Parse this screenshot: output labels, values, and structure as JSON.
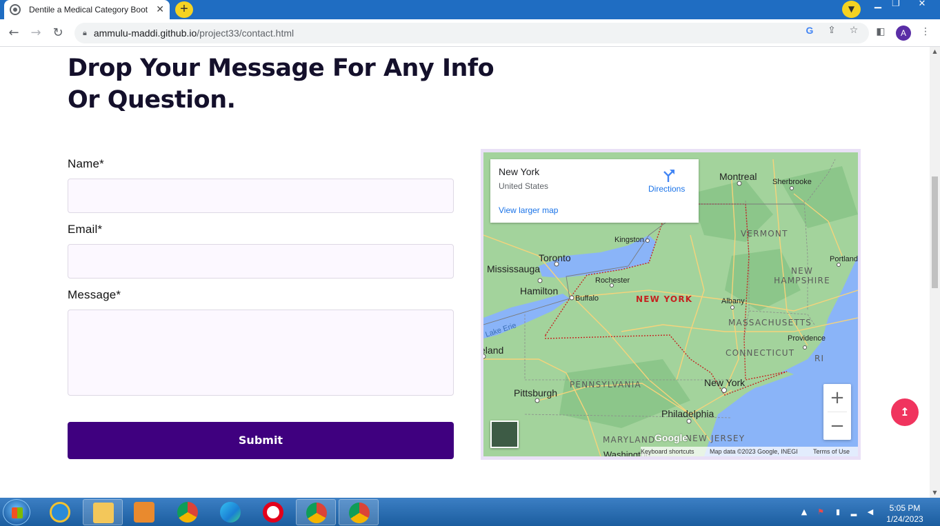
{
  "browser": {
    "tab_title": "Dentile a Medical Category Boot",
    "tab_close": "✕",
    "new_tab": "+",
    "url_host": "ammulu-maddi.github.io",
    "url_path": "/project33/contact.html",
    "profile_initial": "A",
    "window_buttons": [
      "▁",
      "❐",
      "✕"
    ]
  },
  "page": {
    "heading": "Drop Your Message For Any Info Or Question.",
    "form": {
      "name_label": "Name*",
      "email_label": "Email*",
      "message_label": "Message*",
      "submit_label": "Submit"
    },
    "map": {
      "card": {
        "place": "New York",
        "country": "United States",
        "directions": "Directions",
        "larger_map": "View larger map"
      },
      "states": [
        "VERMONT",
        "NEW HAMPSHIRE",
        "NEW YORK",
        "MASSACHUSETTS",
        "CONNECTICUT",
        "RI",
        "PENNSYLVANIA",
        "MARYLAND",
        "NEW JERSEY"
      ],
      "cities": [
        "Montreal",
        "Sherbrooke",
        "Toronto",
        "Mississauga",
        "Kingston",
        "Hamilton",
        "Rochester",
        "Buffalo",
        "Albany",
        "Portland",
        "Providence",
        "New York",
        "Pittsburgh",
        "Philadelphia",
        "Cleveland",
        "Washington"
      ],
      "water": "Lake Erie",
      "zoom_in": "+",
      "zoom_out": "−",
      "footer": {
        "shortcuts": "Keyboard shortcuts",
        "data": "Map data ©2023 Google, INEGI",
        "terms": "Terms of Use"
      },
      "logo": "Google"
    },
    "to_top": "↥"
  },
  "taskbar": {
    "time": "5:05 PM",
    "date": "1/24/2023"
  },
  "colors": {
    "tab_bar": "#1f6dc2",
    "heading": "#14102b",
    "submit": "#3f007f",
    "input_bg": "#fcf8ff",
    "to_top": "#f0345e",
    "map_land": "#9fd29a",
    "map_water": "#8ab4f8"
  }
}
